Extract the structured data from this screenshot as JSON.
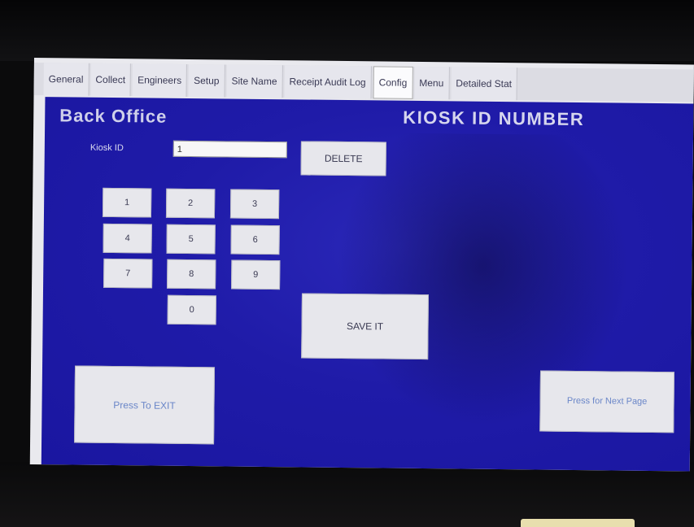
{
  "tabs": [
    {
      "label": "General",
      "active": false
    },
    {
      "label": "Collect",
      "active": false
    },
    {
      "label": "Engineers",
      "active": false
    },
    {
      "label": "Setup",
      "active": false
    },
    {
      "label": "Site Name",
      "active": false
    },
    {
      "label": "Receipt Audit Log",
      "active": false
    },
    {
      "label": "Config",
      "active": true
    },
    {
      "label": "Menu",
      "active": false
    },
    {
      "label": "Detailed Stat",
      "active": false
    }
  ],
  "header": {
    "section_title": "Back Office",
    "page_title": "KIOSK ID NUMBER"
  },
  "kiosk_id": {
    "label": "Kiosk ID",
    "value": "1"
  },
  "buttons": {
    "delete": "DELETE",
    "save": "SAVE IT",
    "exit": "Press To EXIT",
    "next": "Press for Next Page"
  },
  "keypad": [
    "1",
    "2",
    "3",
    "4",
    "5",
    "6",
    "7",
    "8",
    "9",
    "0"
  ],
  "colors": {
    "panel_blue": "#1f1ba8",
    "button_gray": "#e7e7ec",
    "tab_bar": "#dcdce3"
  }
}
